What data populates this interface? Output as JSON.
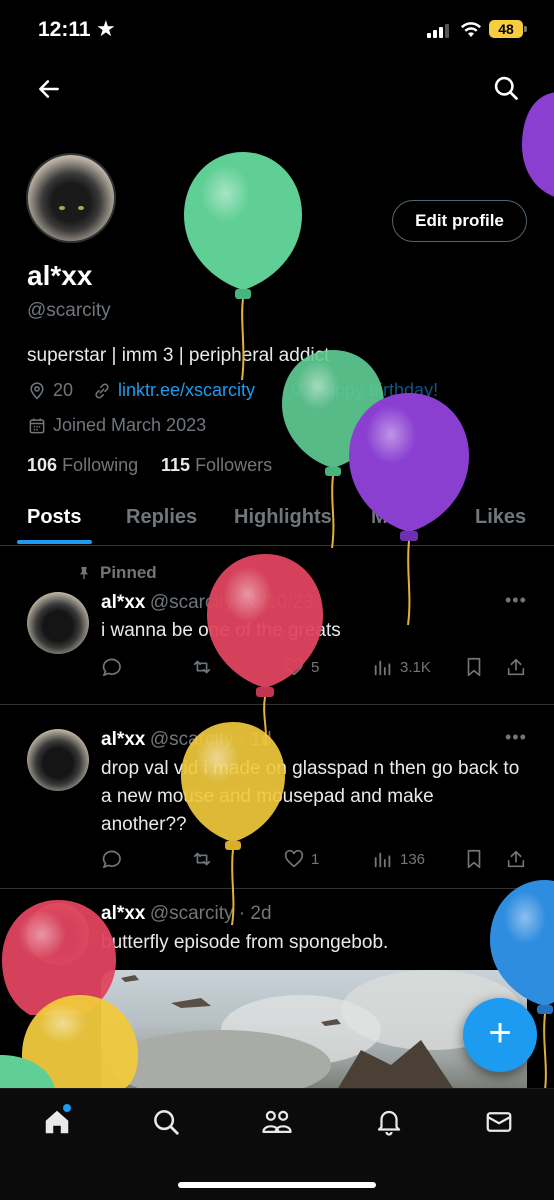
{
  "status_bar": {
    "time": "12:11",
    "battery": "48"
  },
  "profile": {
    "name": "al*xx",
    "handle": "@scarcity",
    "bio": "superstar | imm 3 | peripheral addict",
    "location": "20",
    "link": "linktr.ee/xscarcity",
    "birthday": "Happy birthday!",
    "joined": "Joined March 2023",
    "following_count": "106",
    "following_label": "Following",
    "followers_count": "115",
    "followers_label": "Followers",
    "edit_label": "Edit profile"
  },
  "tabs": [
    "Posts",
    "Replies",
    "Highlights",
    "Media",
    "Likes"
  ],
  "pinned_label": "Pinned",
  "posts": [
    {
      "name": "al*xx",
      "meta": "@scarcity · 8/10/23",
      "text": "i wanna be one of the greats",
      "likes": "5",
      "views": "3.1K"
    },
    {
      "name": "al*xx",
      "meta": "@scarcity · 1d",
      "text": "drop val vid i made on glasspad n then go back to a new mouse and mousepad and make another??",
      "likes": "1",
      "views": "136"
    },
    {
      "name": "al*xx",
      "meta": "@scarcity · 2d",
      "text": "butterfly episode from spongebob."
    }
  ],
  "colors": {
    "accent": "#1d9bf0",
    "balloon_green": "#5fcf95",
    "balloon_purple": "#8a3fd1",
    "balloon_red": "#e0455f",
    "balloon_yellow": "#f0c93c",
    "balloon_blue": "#2f8de0"
  },
  "icons": [
    "back-arrow-icon",
    "search-icon",
    "location-icon",
    "link-icon",
    "balloon-icon",
    "calendar-icon",
    "pin-icon",
    "reply-icon",
    "repost-icon",
    "like-icon",
    "views-icon",
    "bookmark-icon",
    "share-icon",
    "home-icon",
    "explore-icon",
    "communities-icon",
    "notifications-icon",
    "messages-icon",
    "compose-icon"
  ]
}
